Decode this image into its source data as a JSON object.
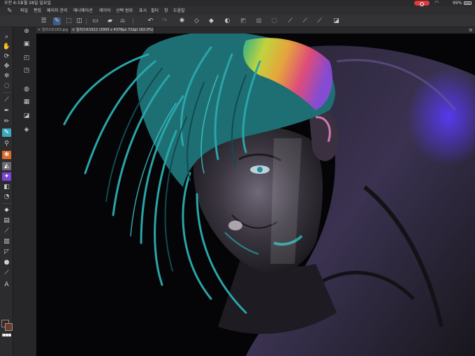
{
  "status": {
    "time": "오전 6:31",
    "date": "2월 28일 일요일",
    "battery": "99%",
    "colors": {
      "record": "#e0393e"
    }
  },
  "menu": {
    "items": [
      "파일",
      "편집",
      "페이지 관리",
      "애니메이션",
      "레이어",
      "선택 범위",
      "표시",
      "필터",
      "창",
      "도움말"
    ]
  },
  "command_bar": {
    "icons": [
      "menu-icon",
      "pen-tool-icon",
      "selection-icon",
      "layer-toggle-icon",
      "new-icon",
      "open-icon",
      "save-icon",
      "undo-icon",
      "redo-icon",
      "transform-icon",
      "deselect-icon",
      "invert-icon",
      "fill-icon",
      "clear-icon",
      "grid-icon",
      "outside-icon",
      "stabilizer-1-icon",
      "stabilizer-2-icon",
      "stabilizer-3-icon",
      "eraser-setting-icon"
    ]
  },
  "tools": [
    "zoom-icon",
    "hand-icon",
    "rotate-icon",
    "move-icon",
    "magic-wand-icon",
    "lasso-icon",
    "eyedropper-icon",
    "pen-icon",
    "pencil-icon",
    "brush-icon",
    "airbrush-icon",
    "decoration-icon",
    "blend-icon",
    "effect-icon",
    "eraser-icon",
    "fill-bucket-icon",
    "gradient-icon",
    "figure-icon",
    "ruler-icon",
    "frame-icon",
    "balloon-icon",
    "correct-line-icon",
    "text-icon"
  ],
  "subtools": [
    "navigator-icon",
    "subtool-icon",
    "tool-property-icon",
    "brush-size-icon",
    "color-wheel-icon",
    "color-set-icon",
    "layer-property-icon",
    "layer-icon",
    "material-icon",
    "history-icon"
  ],
  "tabs": [
    {
      "label": "일러스트163.jpg",
      "active": false
    },
    {
      "label": "일러스트1612 (3000 x 4378px 72dpi 162.0%)",
      "active": true
    }
  ],
  "tab_menu": "≡",
  "colors": {
    "main": "#3a2620",
    "sub": "#6b3a2a",
    "accent": "#3f5d8a",
    "canvas_bg": "#050507"
  }
}
